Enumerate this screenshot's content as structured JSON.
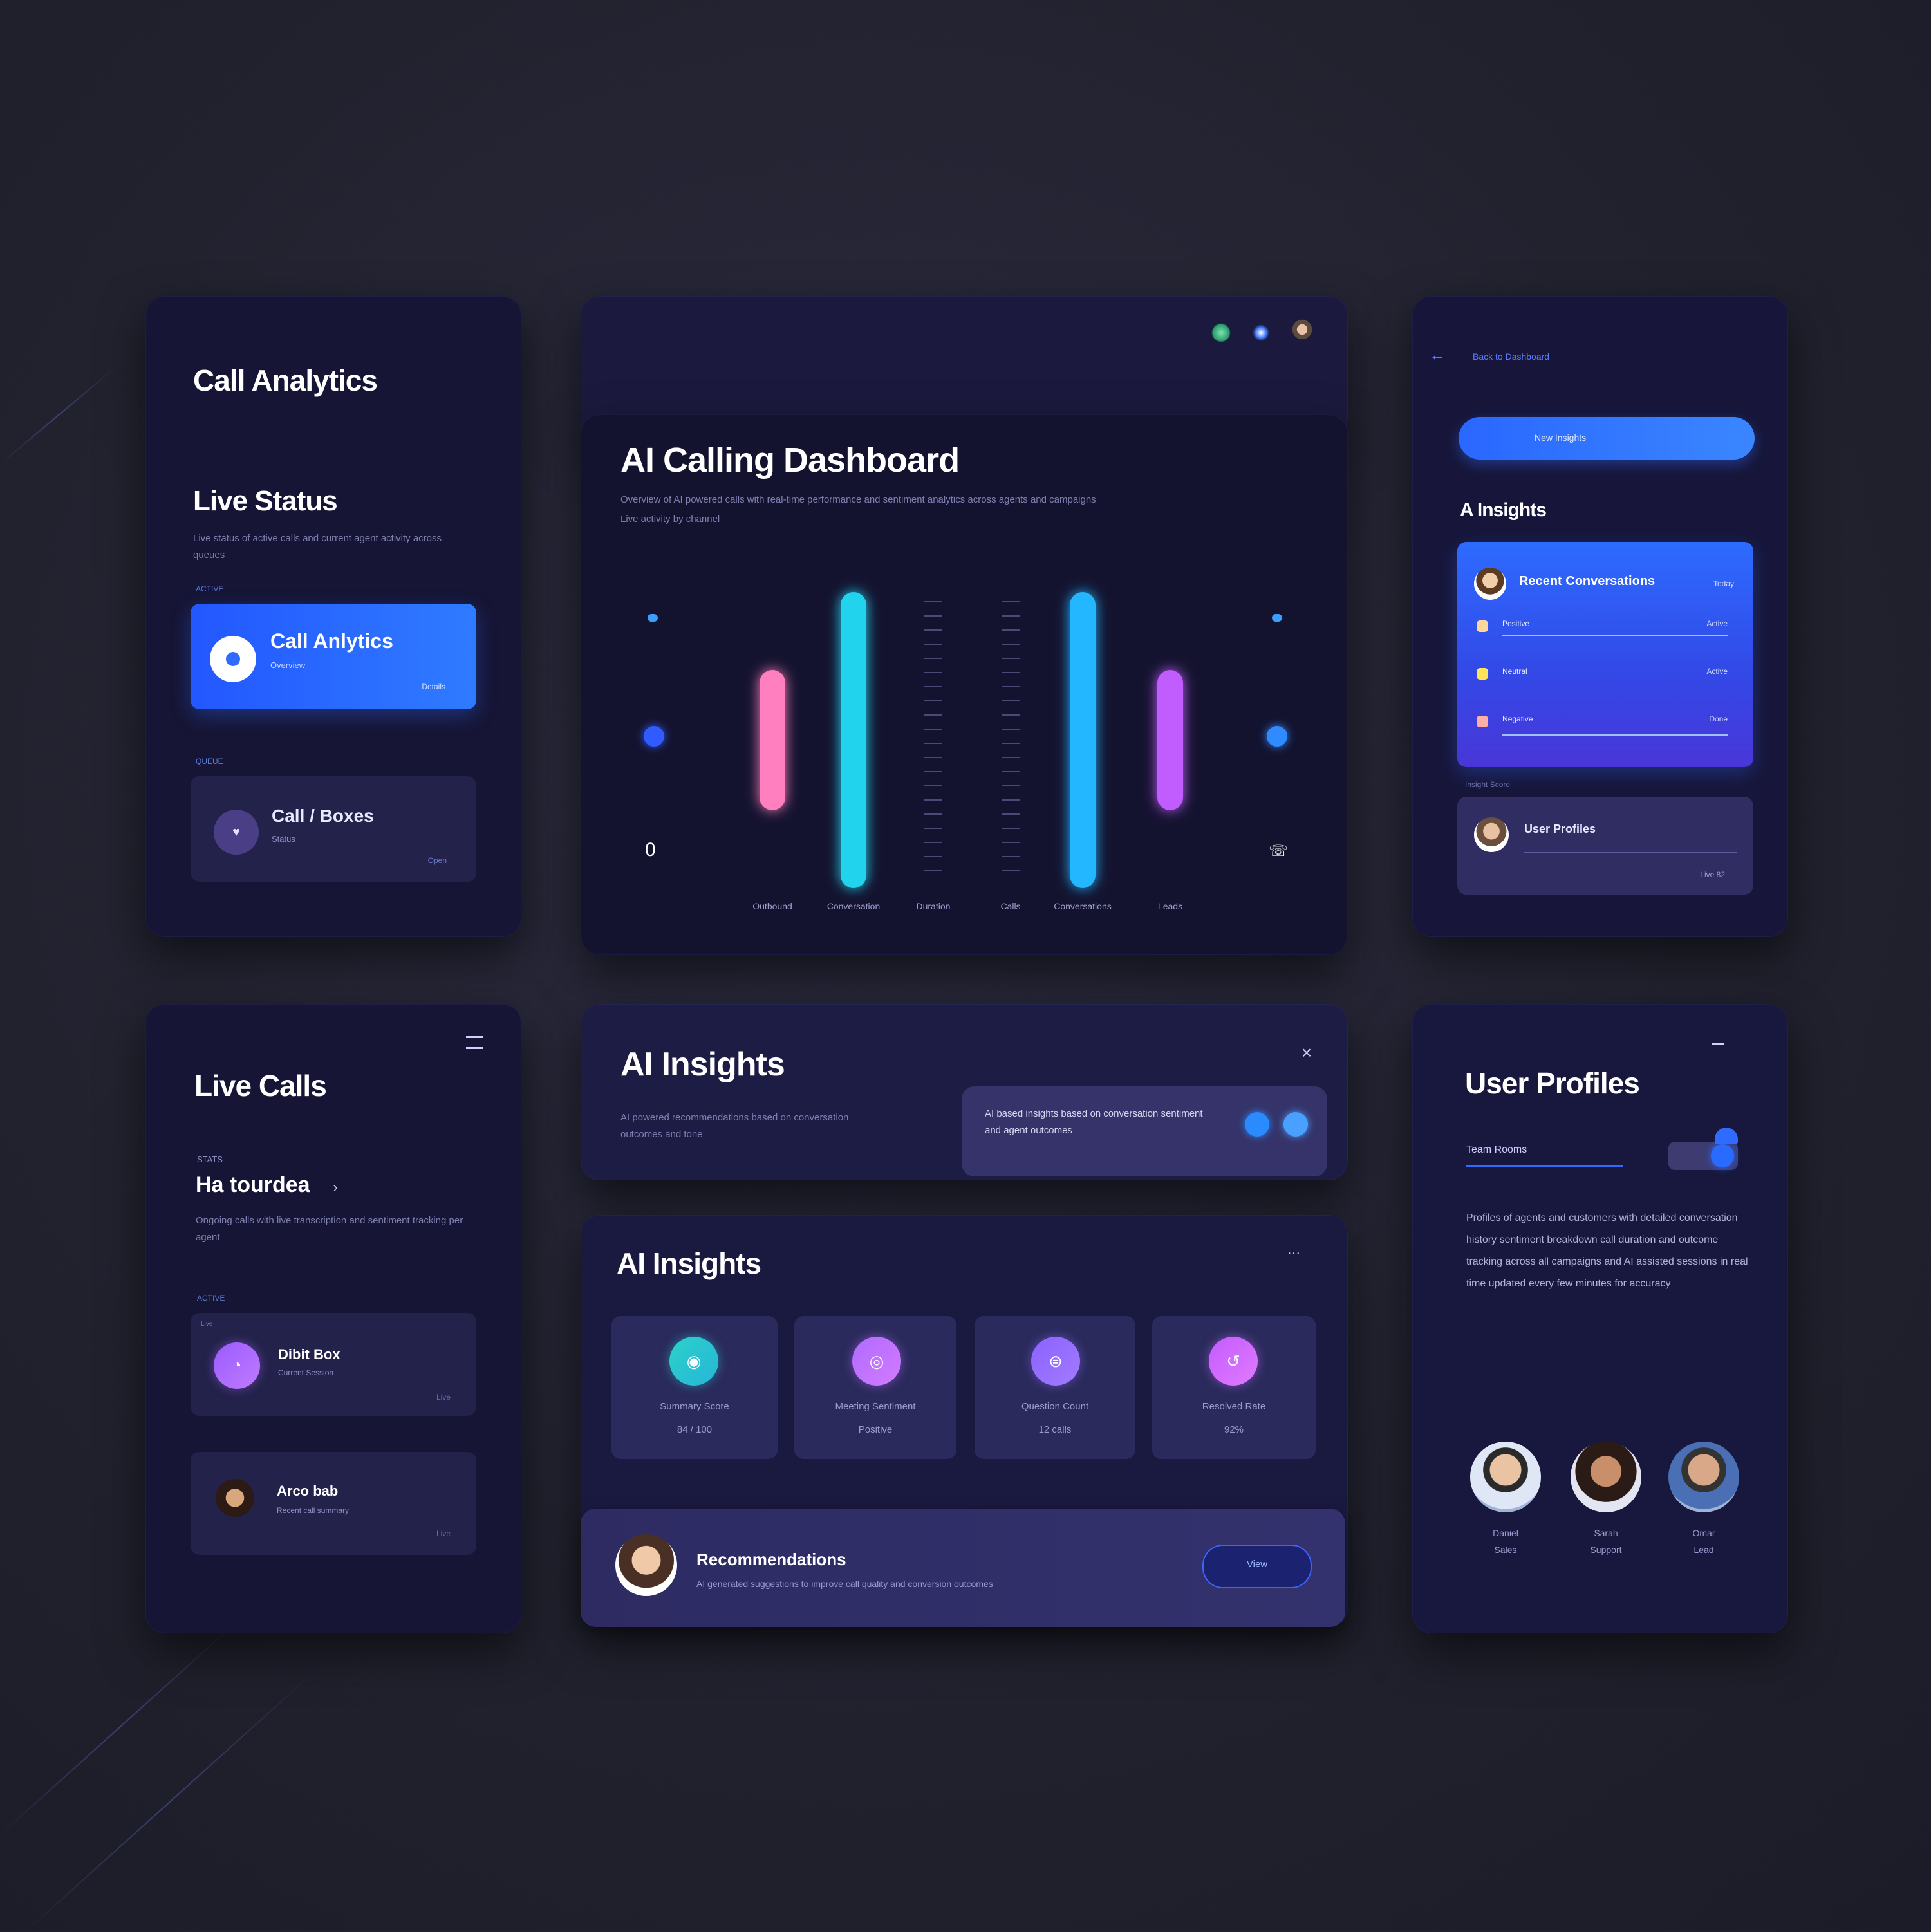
{
  "colors": {
    "accent_blue": "#2f6bff",
    "cyan": "#22d3ee",
    "pink": "#ff7fbf",
    "purple": "#c15bff",
    "card_bg": "#161535"
  },
  "call_analytics": {
    "title": "Call Analytics",
    "section": "Live Status",
    "description": "Live status of active calls and current agent activity across queues",
    "tag1": "ACTIVE",
    "item1_title": "Call Anlytics",
    "item1_sub": "Overview",
    "item1_meta": "Details",
    "tag2": "QUEUE",
    "item2_title": "Call / Boxes",
    "item2_sub": "Status",
    "item2_meta": "Open"
  },
  "dashboard": {
    "title": "AI Calling Dashboard",
    "description": "Overview of AI powered calls with real-time performance and sentiment analytics across agents and campaigns",
    "description2": "Live activity by channel"
  },
  "chart_data": {
    "type": "bar",
    "categories": [
      "Outbound",
      "Conversation",
      "Duration",
      "Calls",
      "Conversations",
      "Leads"
    ],
    "values": [
      45,
      95,
      0,
      0,
      95,
      45
    ],
    "title": "AI Calling Dashboard",
    "xlabel": "",
    "ylabel": "",
    "left_axis_label": "0",
    "grid": false
  },
  "insights_side": {
    "back_label": "Back to Dashboard",
    "pill_label": "New Insights",
    "title": "A Insights",
    "card_title": "Recent Conversations",
    "card_meta": "Today",
    "rows": [
      {
        "label": "Positive",
        "value": "Active"
      },
      {
        "label": "Neutral",
        "value": "Active"
      },
      {
        "label": "Negative",
        "value": "Done"
      }
    ],
    "footer_label": "Insight Score",
    "user_name": "User Profiles",
    "user_meta": "Live 82"
  },
  "live_calls": {
    "title": "Live Calls",
    "tag": "STATS",
    "name": "Ha tourdea",
    "description": "Ongoing calls with live transcription and sentiment tracking per agent",
    "tag2": "ACTIVE",
    "call1_tag": "Live",
    "call1_title": "Dibit Box",
    "call1_sub": "Current Session",
    "call1_meta": "Live",
    "call2_title": "Arco bab",
    "call2_sub": "Recent call summary",
    "call2_meta": "Live"
  },
  "ai_insights_banner": {
    "title": "AI Insights",
    "description": "AI powered recommendations based on conversation outcomes and tone",
    "panel_text": "AI based insights based on conversation sentiment and agent outcomes"
  },
  "ai_insights_grid": {
    "title": "AI Insights",
    "menu": "···",
    "tiles": [
      {
        "label": "Summary Score",
        "sub": "84 / 100"
      },
      {
        "label": "Meeting Sentiment",
        "sub": "Positive"
      },
      {
        "label": "Question Count",
        "sub": "12 calls"
      },
      {
        "label": "Resolved Rate",
        "sub": "92%"
      }
    ]
  },
  "recommendation": {
    "name": "Recommendations",
    "description": "AI generated suggestions to improve call quality and conversion outcomes",
    "button_label": "View"
  },
  "user_profiles": {
    "title": "User Profiles",
    "tab": "Team Rooms",
    "description": "Profiles of agents and customers with detailed conversation history sentiment breakdown call duration and outcome tracking across all campaigns and AI assisted sessions in real time updated every few minutes for accuracy",
    "people": [
      {
        "name": "Daniel",
        "sub": "Sales"
      },
      {
        "name": "Sarah",
        "sub": "Support"
      },
      {
        "name": "Omar",
        "sub": "Lead"
      }
    ]
  }
}
